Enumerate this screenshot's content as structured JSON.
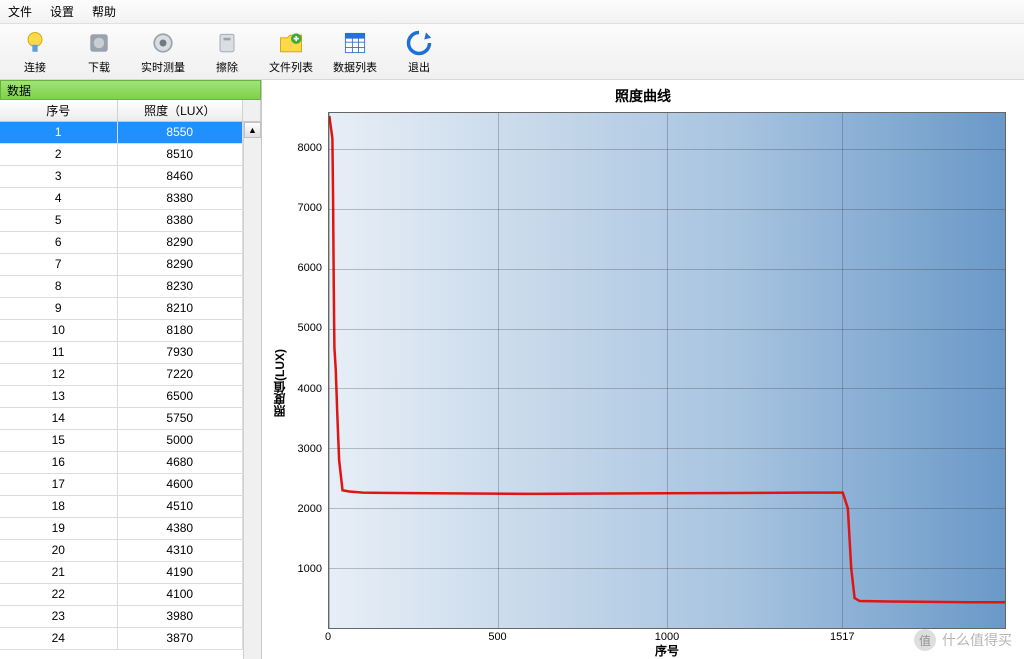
{
  "menu": {
    "file": "文件",
    "settings": "设置",
    "help": "帮助"
  },
  "toolbar": [
    {
      "key": "connect",
      "label": "连接"
    },
    {
      "key": "download",
      "label": "下载"
    },
    {
      "key": "realtime",
      "label": "实时测量"
    },
    {
      "key": "erase",
      "label": "擦除"
    },
    {
      "key": "filelist",
      "label": "文件列表"
    },
    {
      "key": "datalist",
      "label": "数据列表"
    },
    {
      "key": "exit",
      "label": "退出"
    }
  ],
  "panel": {
    "title": "数据"
  },
  "table": {
    "head_index": "序号",
    "head_value": "照度（LUX）",
    "rows": [
      {
        "i": 1,
        "v": 8550
      },
      {
        "i": 2,
        "v": 8510
      },
      {
        "i": 3,
        "v": 8460
      },
      {
        "i": 4,
        "v": 8380
      },
      {
        "i": 5,
        "v": 8380
      },
      {
        "i": 6,
        "v": 8290
      },
      {
        "i": 7,
        "v": 8290
      },
      {
        "i": 8,
        "v": 8230
      },
      {
        "i": 9,
        "v": 8210
      },
      {
        "i": 10,
        "v": 8180
      },
      {
        "i": 11,
        "v": 7930
      },
      {
        "i": 12,
        "v": 7220
      },
      {
        "i": 13,
        "v": 6500
      },
      {
        "i": 14,
        "v": 5750
      },
      {
        "i": 15,
        "v": 5000
      },
      {
        "i": 16,
        "v": 4680
      },
      {
        "i": 17,
        "v": 4600
      },
      {
        "i": 18,
        "v": 4510
      },
      {
        "i": 19,
        "v": 4380
      },
      {
        "i": 20,
        "v": 4310
      },
      {
        "i": 21,
        "v": 4190
      },
      {
        "i": 22,
        "v": 4100
      },
      {
        "i": 23,
        "v": 3980
      },
      {
        "i": 24,
        "v": 3870
      }
    ],
    "selected": 1
  },
  "chart_data": {
    "type": "line",
    "title": "照度曲线",
    "xlabel": "序号",
    "ylabel": "照度值(LUX)",
    "xlim": [
      0,
      2000
    ],
    "ylim": [
      0,
      8600
    ],
    "x_ticks": [
      0,
      500,
      1000,
      1517
    ],
    "y_ticks": [
      1000,
      2000,
      3000,
      4000,
      5000,
      6000,
      7000,
      8000
    ],
    "series": [
      {
        "name": "照度",
        "color": "#e11414",
        "points": [
          {
            "x": 1,
            "y": 8550
          },
          {
            "x": 5,
            "y": 8380
          },
          {
            "x": 10,
            "y": 8180
          },
          {
            "x": 12,
            "y": 7220
          },
          {
            "x": 14,
            "y": 5750
          },
          {
            "x": 16,
            "y": 4680
          },
          {
            "x": 20,
            "y": 4310
          },
          {
            "x": 25,
            "y": 3500
          },
          {
            "x": 30,
            "y": 2800
          },
          {
            "x": 40,
            "y": 2300
          },
          {
            "x": 60,
            "y": 2280
          },
          {
            "x": 100,
            "y": 2260
          },
          {
            "x": 300,
            "y": 2250
          },
          {
            "x": 600,
            "y": 2240
          },
          {
            "x": 1000,
            "y": 2250
          },
          {
            "x": 1400,
            "y": 2260
          },
          {
            "x": 1520,
            "y": 2260
          },
          {
            "x": 1535,
            "y": 2000
          },
          {
            "x": 1545,
            "y": 1000
          },
          {
            "x": 1555,
            "y": 500
          },
          {
            "x": 1570,
            "y": 450
          },
          {
            "x": 1700,
            "y": 440
          },
          {
            "x": 1900,
            "y": 430
          },
          {
            "x": 2000,
            "y": 430
          }
        ]
      }
    ]
  },
  "watermark": {
    "text": "什么值得买",
    "badge": "值"
  }
}
